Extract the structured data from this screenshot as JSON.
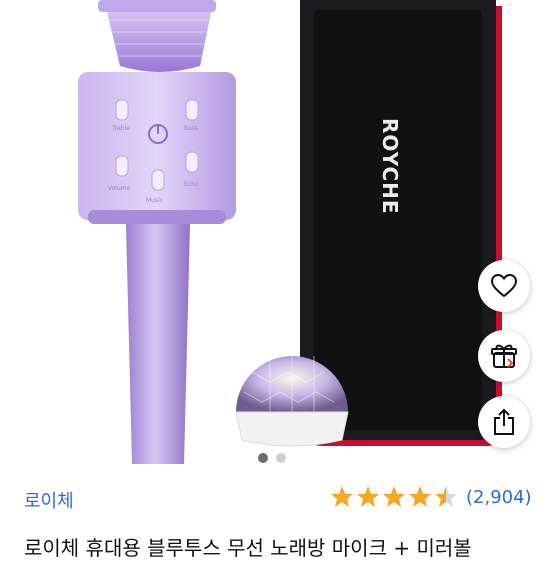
{
  "product": {
    "brand_on_box": "ROYCHE",
    "mic_buttons": [
      "Treble",
      "Bass",
      "Volume",
      "Echo",
      "Music"
    ],
    "seller": "로이체",
    "rating": 4.5,
    "rating_max": 5,
    "reviews_count": "(2,904)",
    "title": "로이체 휴대용 블루투스 무선 노래방 마이크 + 미러볼"
  },
  "carousel": {
    "total": 2,
    "active_index": 0
  },
  "actions": {
    "wishlist_icon": "heart-icon",
    "gift_icon": "gift-icon",
    "share_icon": "share-icon"
  },
  "colors": {
    "rating_star": "#f5a623",
    "link_blue": "#2a6fd6",
    "box_accent": "#c8102e",
    "mic_purple": "#b79ae6"
  }
}
